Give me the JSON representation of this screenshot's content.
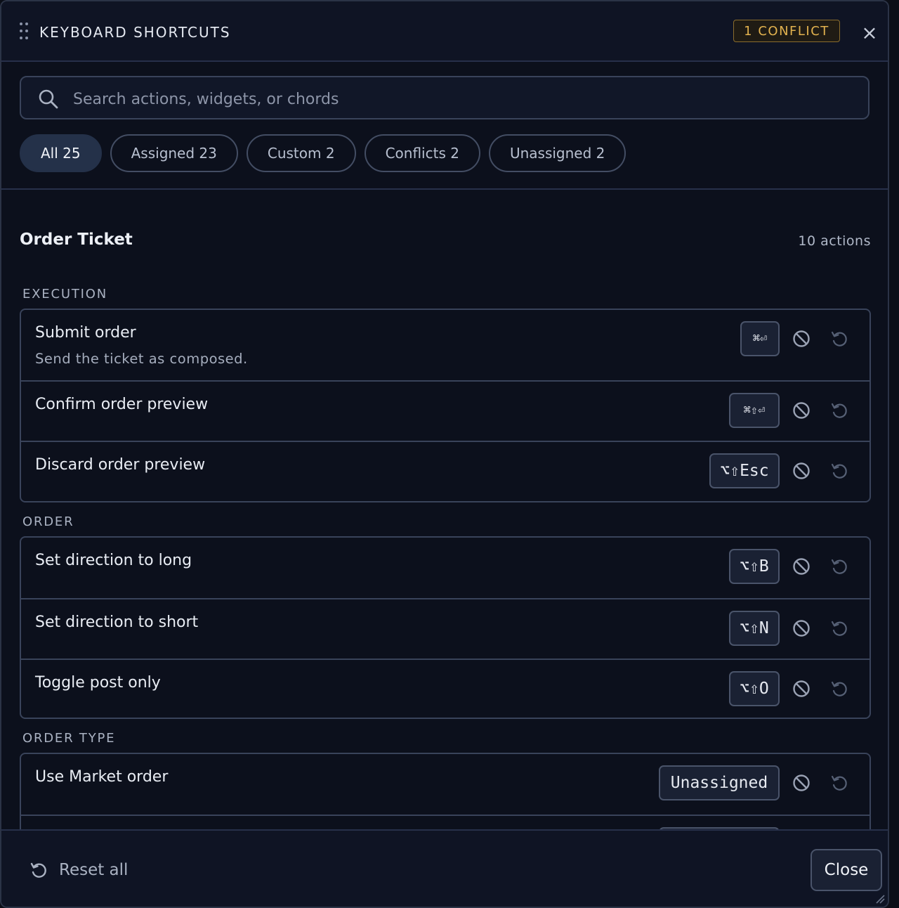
{
  "header": {
    "title": "KEYBOARD SHORTCUTS",
    "conflict_badge": "1 CONFLICT",
    "close_glyph": "×"
  },
  "search": {
    "placeholder": "Search actions, widgets, or chords",
    "value": ""
  },
  "filters": [
    {
      "label": "All 25",
      "active": true
    },
    {
      "label": "Assigned 23",
      "active": false
    },
    {
      "label": "Custom 2",
      "active": false
    },
    {
      "label": "Conflicts 2",
      "active": false
    },
    {
      "label": "Unassigned 2",
      "active": false
    }
  ],
  "section": {
    "title": "Order Ticket",
    "count": "10 actions"
  },
  "groups": [
    {
      "label": "EXECUTION",
      "rows": [
        {
          "name": "Submit order",
          "description": "Send the ticket as composed.",
          "chord": "⌘⏎"
        },
        {
          "name": "Confirm order preview",
          "chord": "⌘⇧⏎"
        },
        {
          "name": "Discard order preview",
          "chord": "⌥⇧Esc"
        }
      ]
    },
    {
      "label": "ORDER",
      "rows": [
        {
          "name": "Set direction to long",
          "chord": "⌥⇧B"
        },
        {
          "name": "Set direction to short",
          "chord": "⌥⇧N"
        },
        {
          "name": "Toggle post only",
          "chord": "⌥⇧O"
        }
      ]
    },
    {
      "label": "ORDER TYPE",
      "rows": [
        {
          "name": "Use Market order",
          "chord": "Unassigned"
        },
        {
          "name": "",
          "chord": ""
        }
      ]
    }
  ],
  "footer": {
    "reset_all": "Reset all",
    "close": "Close"
  },
  "icons": {
    "grip": "drag-handle-icon",
    "search": "search-icon",
    "clear": "ban-icon",
    "reset": "reset-icon",
    "resize": "resize-grip-icon"
  },
  "colors": {
    "background": "#0c101c",
    "accent_warning": "#e2b24f",
    "active_chip": "#243149"
  }
}
